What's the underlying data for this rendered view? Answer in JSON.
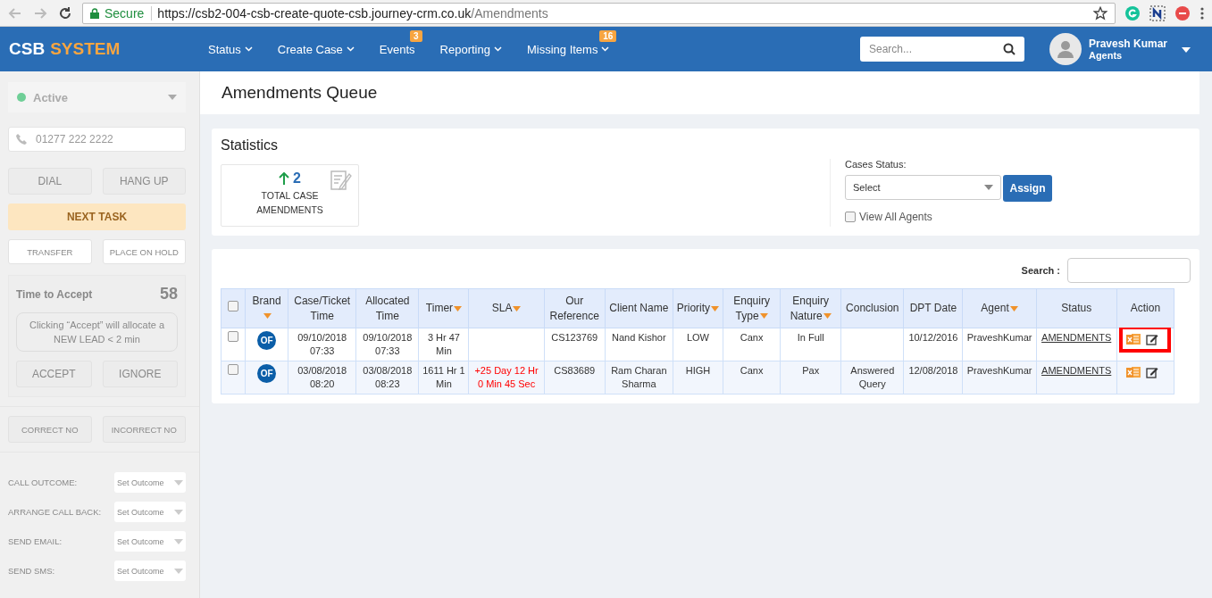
{
  "browser": {
    "secure_label": "Secure",
    "url_host": "https://csb2-004-csb-create-quote-csb.journey-crm.co.uk",
    "url_path": "/Amendments"
  },
  "navbar": {
    "logo": [
      "CSB",
      "SYSTEM"
    ],
    "menu": [
      {
        "label": "Status",
        "dropdown": true
      },
      {
        "label": "Create Case",
        "dropdown": true
      },
      {
        "label": "Events",
        "dropdown": false,
        "badge": "3"
      },
      {
        "label": "Reporting",
        "dropdown": true
      },
      {
        "label": "Missing Items",
        "dropdown": true,
        "badge": "16"
      }
    ],
    "search_placeholder": "Search...",
    "user": {
      "name": "Pravesh Kumar",
      "role": "Agents"
    }
  },
  "sidebar": {
    "status": {
      "label": "Active",
      "color": "#6fcf97"
    },
    "phone_placeholder": "01277 222 2222",
    "call_buttons": [
      "DIAL",
      "HANG UP"
    ],
    "next_task": "NEXT TASK",
    "hold_buttons": [
      "TRANSFER",
      "PLACE ON HOLD"
    ],
    "accept_panel": {
      "title": "Time to Accept",
      "countdown": "58",
      "note": "Clicking “Accept” will allocate a NEW LEAD < 2 min",
      "buttons": [
        "ACCEPT",
        "IGNORE"
      ]
    },
    "number_buttons": [
      "CORRECT NO",
      "INCORRECT NO"
    ],
    "outcomes": [
      {
        "label": "CALL OUTCOME:",
        "value": "Set Outcome"
      },
      {
        "label": "ARRANGE CALL BACK:",
        "value": "Set Outcome"
      },
      {
        "label": "SEND EMAIL:",
        "value": "Set Outcome"
      },
      {
        "label": "SEND SMS:",
        "value": "Set Outcome"
      }
    ]
  },
  "page_title": "Amendments Queue",
  "statistics": {
    "title": "Statistics",
    "tile": {
      "count": "2",
      "label": "TOTAL CASE AMENDMENTS"
    },
    "cases_status": {
      "label": "Cases Status:",
      "placeholder": "Select",
      "button": "Assign"
    },
    "view_all_agents": {
      "label": "View All Agents",
      "checked": false
    }
  },
  "table": {
    "search_label": "Search :",
    "select_all_checked": false,
    "columns": [
      {
        "label": "Brand",
        "sortable": true
      },
      {
        "label": "Case/Ticket Time",
        "sortable": false
      },
      {
        "label": "Allocated Time",
        "sortable": false
      },
      {
        "label": "Timer",
        "sortable": true
      },
      {
        "label": "SLA",
        "sortable": true
      },
      {
        "label": "Our Reference",
        "sortable": false
      },
      {
        "label": "Client Name",
        "sortable": false
      },
      {
        "label": "Priority",
        "sortable": true
      },
      {
        "label": "Enquiry Type",
        "sortable": true
      },
      {
        "label": "Enquiry Nature",
        "sortable": true
      },
      {
        "label": "Conclusion",
        "sortable": false
      },
      {
        "label": "DPT Date",
        "sortable": false
      },
      {
        "label": "Agent",
        "sortable": true
      },
      {
        "label": "Status",
        "sortable": false
      },
      {
        "label": "Action",
        "sortable": false
      }
    ],
    "rows": [
      {
        "checked": false,
        "brand": "OF",
        "case_time": "09/10/2018 07:33",
        "allocated_time": "09/10/2018 07:33",
        "timer": "3 Hr 47 Min",
        "sla": "",
        "sla_overdue": false,
        "reference": "CS123769",
        "client": "Nand Kishor",
        "priority": "LOW",
        "enquiry_type": "Canx",
        "enquiry_nature": "In Full",
        "conclusion": "",
        "dpt_date": "10/12/2016",
        "agent": "PraveshKumar",
        "status": "AMENDMENTS",
        "highlighted": true
      },
      {
        "checked": false,
        "brand": "OF",
        "case_time": "03/08/2018 08:20",
        "allocated_time": "03/08/2018 08:23",
        "timer": "1611 Hr 1 Min",
        "sla": "+25 Day 12 Hr 0 Min 45 Sec",
        "sla_overdue": true,
        "reference": "CS83689",
        "client": "Ram Charan Sharma",
        "priority": "HIGH",
        "enquiry_type": "Canx",
        "enquiry_nature": "Pax",
        "conclusion": "Answered Query",
        "dpt_date": "12/08/2018",
        "agent": "PraveshKumar",
        "status": "AMENDMENTS",
        "highlighted": false
      }
    ]
  }
}
